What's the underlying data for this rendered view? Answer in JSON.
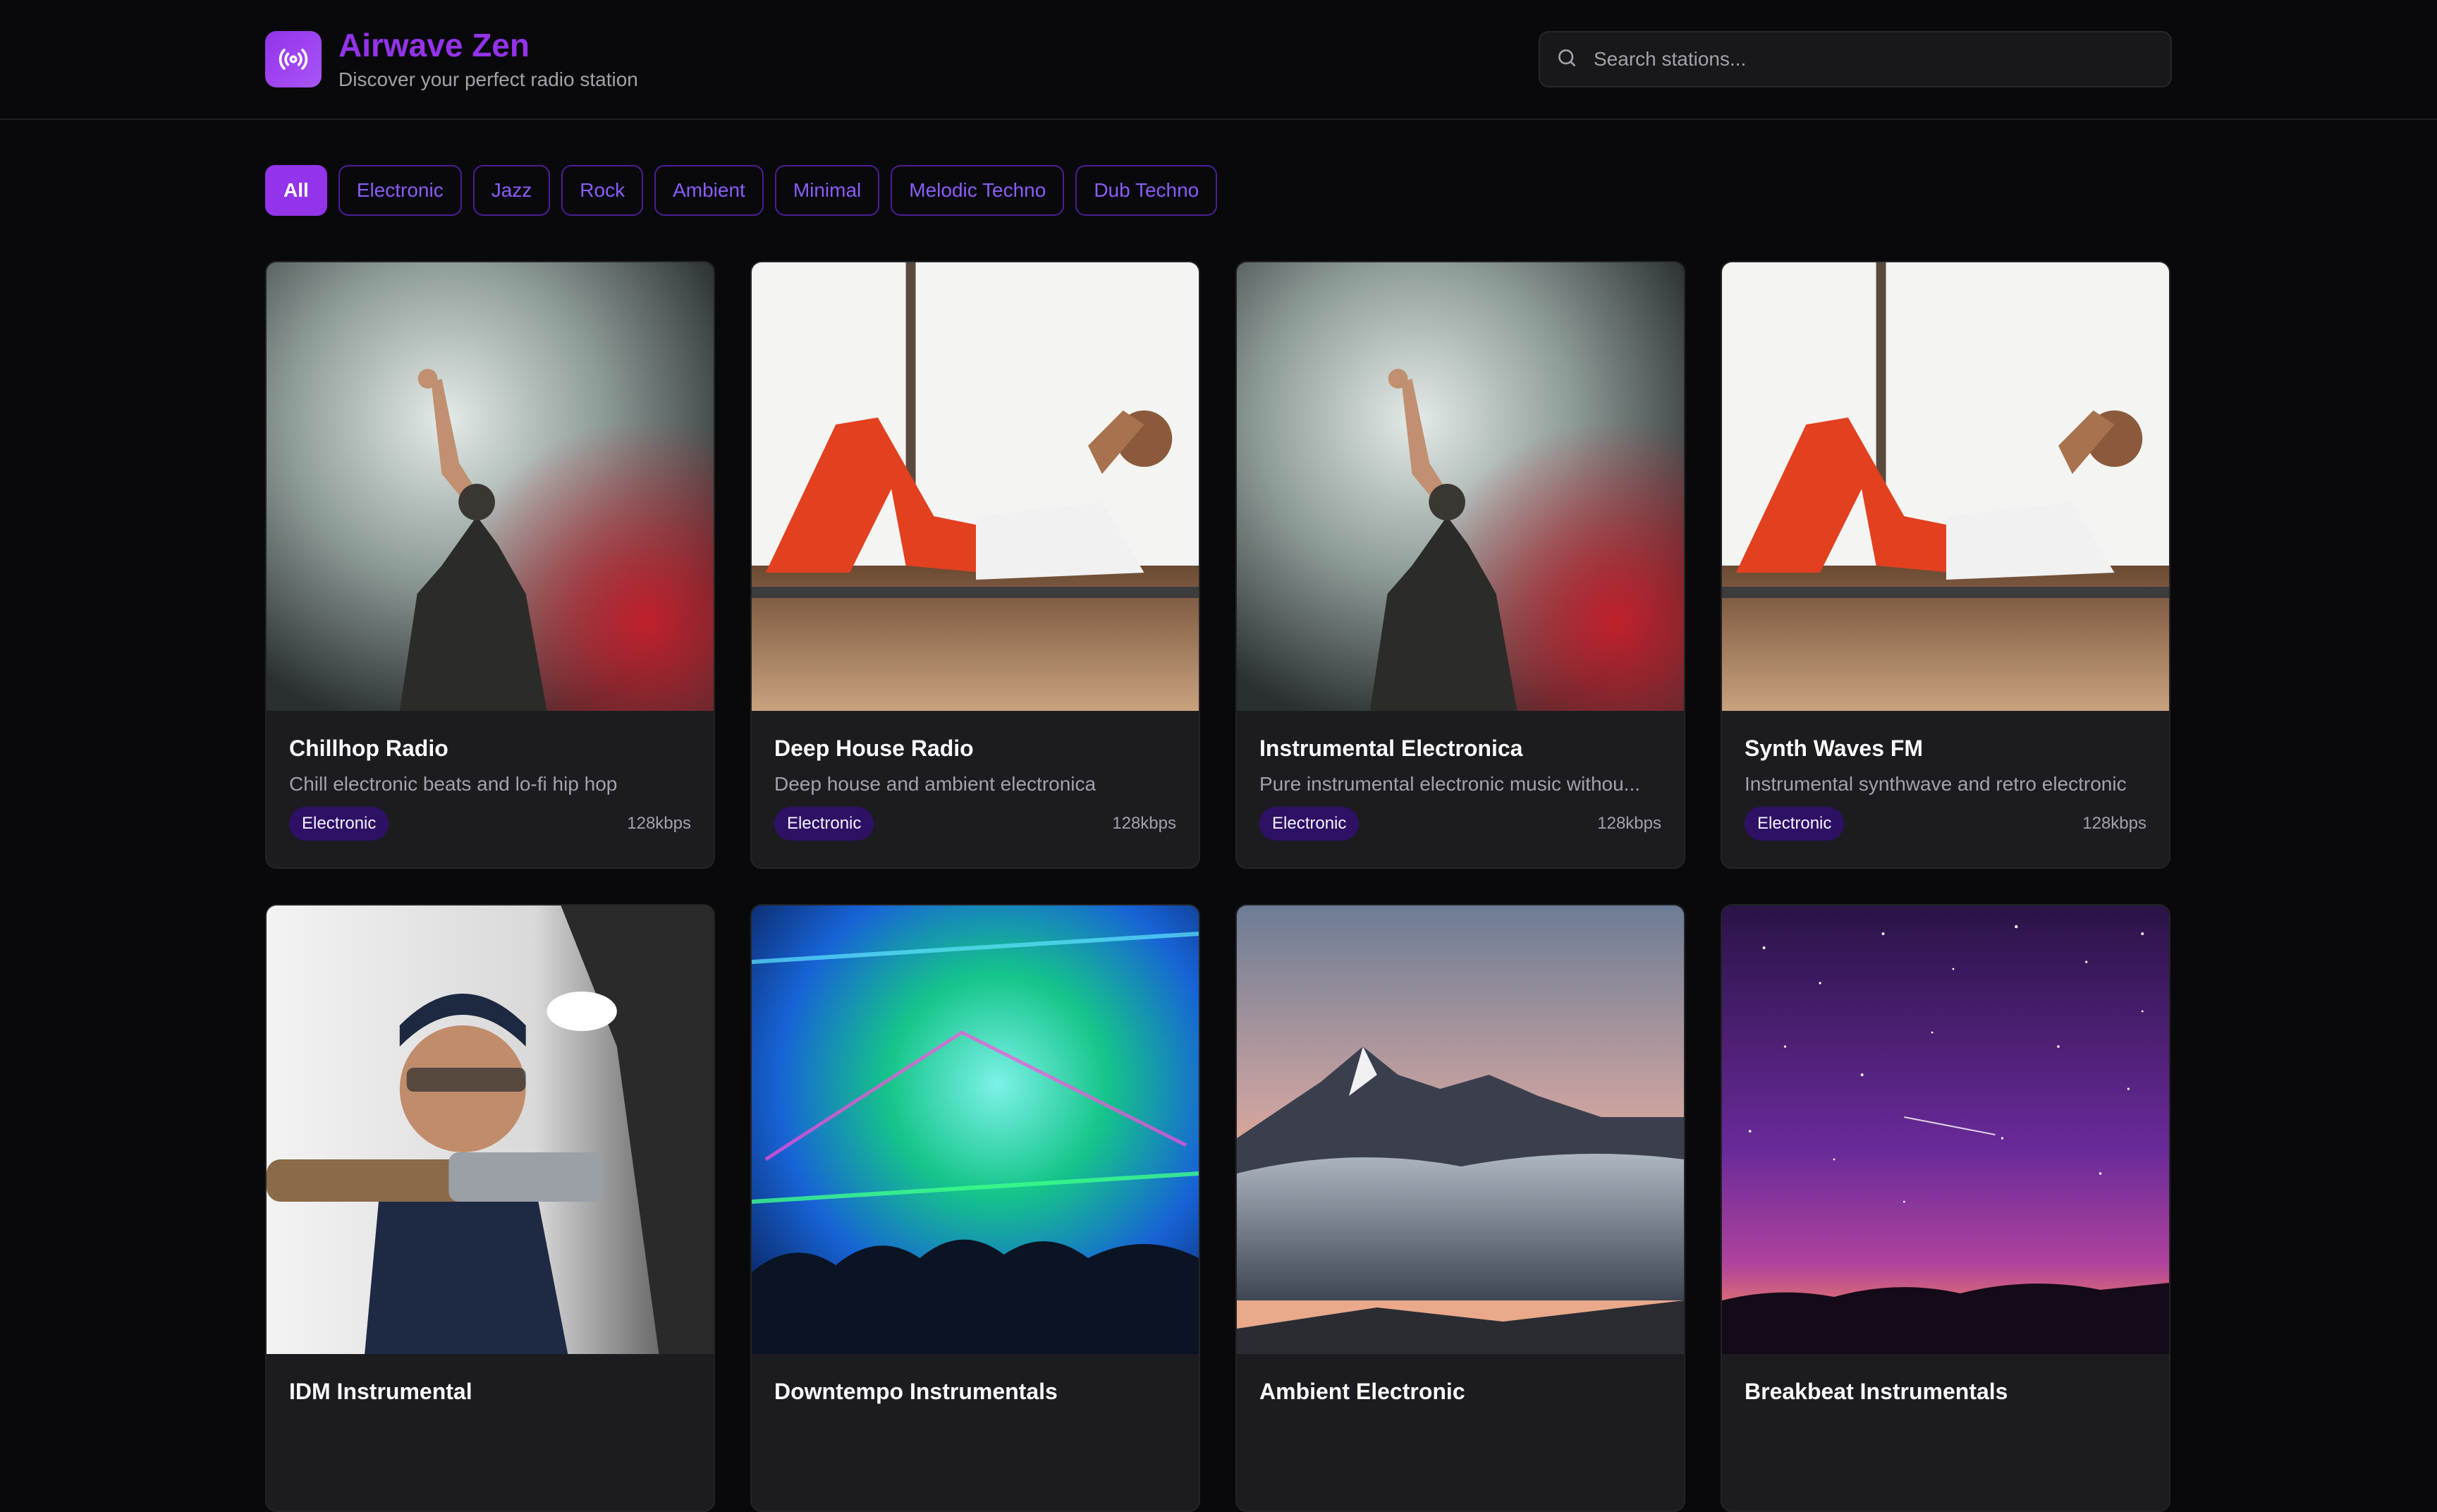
{
  "app": {
    "title": "Airwave Zen",
    "subtitle": "Discover your perfect radio station",
    "logo_icon": "radio-broadcast-icon",
    "accent_color": "#9333ea"
  },
  "search": {
    "placeholder": "Search stations...",
    "value": "",
    "icon": "search-icon"
  },
  "filters": [
    {
      "label": "All",
      "active": true
    },
    {
      "label": "Electronic",
      "active": false
    },
    {
      "label": "Jazz",
      "active": false
    },
    {
      "label": "Rock",
      "active": false
    },
    {
      "label": "Ambient",
      "active": false
    },
    {
      "label": "Minimal",
      "active": false
    },
    {
      "label": "Melodic Techno",
      "active": false
    },
    {
      "label": "Dub Techno",
      "active": false
    }
  ],
  "stations": [
    {
      "name": "Chillhop Radio",
      "description": "Chill electronic beats and lo-fi hip hop",
      "genre": "Electronic",
      "bitrate": "128kbps",
      "image": "performer in smoke"
    },
    {
      "name": "Deep House Radio",
      "description": "Deep house and ambient electronica",
      "genre": "Electronic",
      "bitrate": "128kbps",
      "image": "woman doing crunches"
    },
    {
      "name": "Instrumental Electronica",
      "description": "Pure instrumental electronic music withou...",
      "genre": "Electronic",
      "bitrate": "128kbps",
      "image": "performer in smoke"
    },
    {
      "name": "Synth Waves FM",
      "description": "Instrumental synthwave and retro electronic",
      "genre": "Electronic",
      "bitrate": "128kbps",
      "image": "woman doing crunches"
    },
    {
      "name": "IDM Instrumental",
      "description": "",
      "genre": "",
      "bitrate": "",
      "image": "man with machinery"
    },
    {
      "name": "Downtempo Instrumentals",
      "description": "",
      "genre": "",
      "bitrate": "",
      "image": "concert crowd lights"
    },
    {
      "name": "Ambient Electronic",
      "description": "",
      "genre": "",
      "bitrate": "",
      "image": "mountains above clouds"
    },
    {
      "name": "Breakbeat Instrumentals",
      "description": "",
      "genre": "",
      "bitrate": "",
      "image": "starry night sky"
    }
  ]
}
